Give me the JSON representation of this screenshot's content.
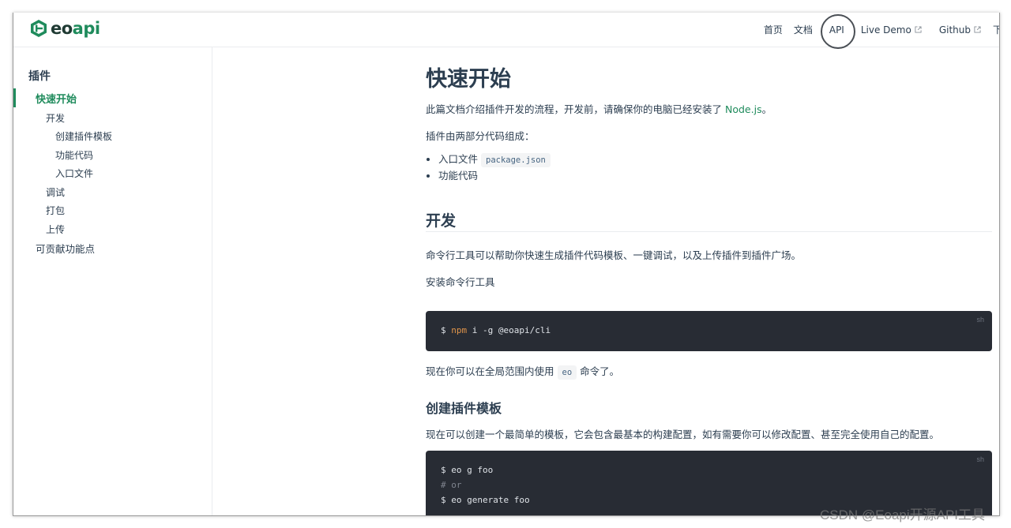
{
  "brand": {
    "logo_eo": "eo",
    "logo_api": "api",
    "accent_color": "#1f8b5c"
  },
  "nav": {
    "home": "首页",
    "docs": "文档",
    "api": "API",
    "live_demo": "Live Demo",
    "github": "Github",
    "download": "下"
  },
  "sidebar": {
    "group_title": "插件",
    "items": [
      {
        "label": "快速开始",
        "level": 1,
        "active": true
      },
      {
        "label": "开发",
        "level": 2
      },
      {
        "label": "创建插件模板",
        "level": 3
      },
      {
        "label": "功能代码",
        "level": 3
      },
      {
        "label": "入口文件",
        "level": 3
      },
      {
        "label": "调试",
        "level": 2
      },
      {
        "label": "打包",
        "level": 2
      },
      {
        "label": "上传",
        "level": 2
      },
      {
        "label": "可贡献功能点",
        "level": 1
      }
    ]
  },
  "content": {
    "title": "快速开始",
    "intro_before_link": "此篇文档介绍插件开发的流程，开发前，请确保你的电脑已经安装了",
    "intro_link": "Node.js",
    "intro_after_link": "。",
    "parts_intro": "插件由两部分代码组成：",
    "parts": [
      {
        "text": "入口文件",
        "code": "package.json"
      },
      {
        "text": "功能代码",
        "code": ""
      }
    ],
    "dev_heading": "开发",
    "dev_desc": "命令行工具可以帮助你快速生成插件代码模板、一键调试，以及上传插件到插件广场。",
    "install_label": "安装命令行工具",
    "code1": {
      "lang": "sh",
      "prompt": "$",
      "cmd": "npm",
      "rest": " i -g @eoapi/cli"
    },
    "usage_before": "现在你可以在全局范围内使用",
    "usage_code": "eo",
    "usage_after": "命令了。",
    "template_heading": "创建插件模板",
    "template_desc": "现在可以创建一个最简单的模板，它会包含最基本的构建配置，如有需要你可以修改配置、甚至完全使用自己的配置。",
    "code2": {
      "lang": "sh",
      "line1": "$ eo g foo",
      "line2": "# or",
      "line3": "$ eo generate foo"
    }
  },
  "watermark": "CSDN @Eoapi开源API工具"
}
